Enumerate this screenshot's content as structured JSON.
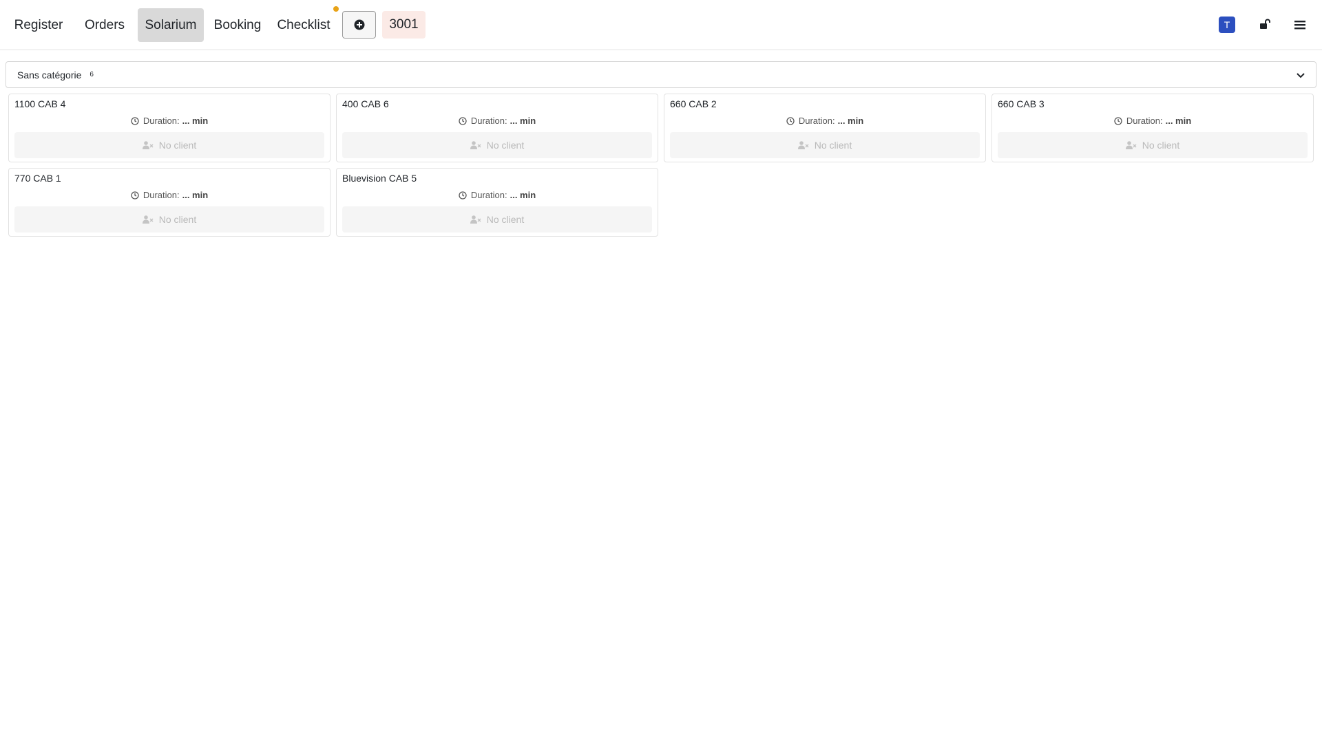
{
  "nav": {
    "tabs": [
      {
        "label": "Register"
      },
      {
        "label": "Orders"
      },
      {
        "label": "Solarium"
      },
      {
        "label": "Booking"
      },
      {
        "label": "Checklist"
      }
    ],
    "active_tab": "Solarium",
    "add_icon": "plus-circle-icon",
    "table_number": "3001",
    "user_initial": "T",
    "lock_icon": "unlock-icon",
    "menu_icon": "hamburger-menu-icon",
    "colors": {
      "active_tab_bg": "#d9d9d9",
      "notification_dot": "#e8a317",
      "table_badge_bg": "#fbeae6",
      "avatar_bg": "#2c4fbf"
    }
  },
  "category": {
    "name": "Sans catégorie",
    "count": "6",
    "chevron_icon": "chevron-down-icon"
  },
  "cabins": [
    {
      "name": "1100 CAB 4",
      "duration_label": "Duration:",
      "duration_value": "... min",
      "client": "No client"
    },
    {
      "name": "400 CAB 6",
      "duration_label": "Duration:",
      "duration_value": "... min",
      "client": "No client"
    },
    {
      "name": "660 CAB 2",
      "duration_label": "Duration:",
      "duration_value": "... min",
      "client": "No client"
    },
    {
      "name": "660 CAB 3",
      "duration_label": "Duration:",
      "duration_value": "... min",
      "client": "No client"
    },
    {
      "name": "770 CAB 1",
      "duration_label": "Duration:",
      "duration_value": "... min",
      "client": "No client"
    },
    {
      "name": "Bluevision CAB 5",
      "duration_label": "Duration:",
      "duration_value": "... min",
      "client": "No client"
    }
  ]
}
